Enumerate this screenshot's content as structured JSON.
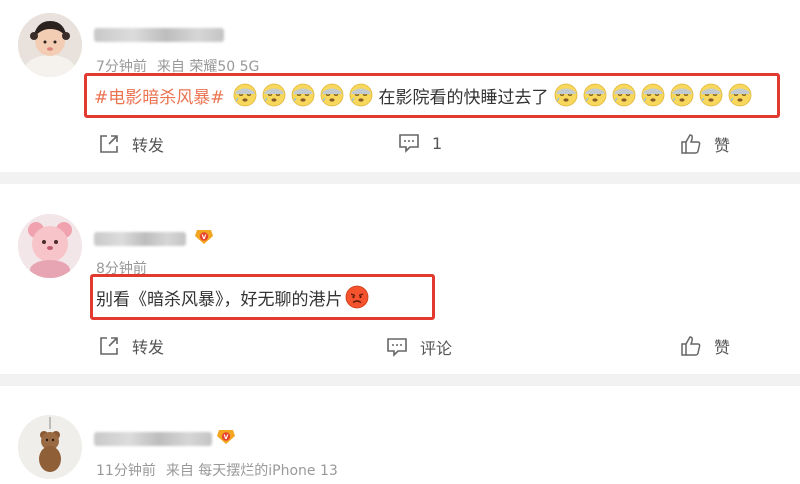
{
  "posts": [
    {
      "meta": {
        "time": "7分钟前",
        "source": "来自 荣耀50 5G"
      },
      "content": {
        "hashtag": "#电影暗杀风暴#",
        "text": "在影院看的快睡过去了"
      },
      "actions": {
        "repost": "转发",
        "comment": "1",
        "like": "赞"
      }
    },
    {
      "meta": {
        "time": "8分钟前",
        "source": ""
      },
      "content": {
        "text": "别看《暗杀风暴》，好无聊的港片"
      },
      "actions": {
        "repost": "转发",
        "comment": "评论",
        "like": "赞"
      }
    },
    {
      "meta": {
        "time": "11分钟前",
        "source": "来自 每天摆烂的iPhone 13"
      }
    }
  ],
  "emoji": {
    "sleepy": "sleepy-face-icon",
    "angry": "angry-face-icon"
  },
  "colors": {
    "highlight_border": "#e23a2e",
    "hashtag": "#eb7350",
    "meta": "#999999",
    "separator": "#f2f2f2"
  }
}
